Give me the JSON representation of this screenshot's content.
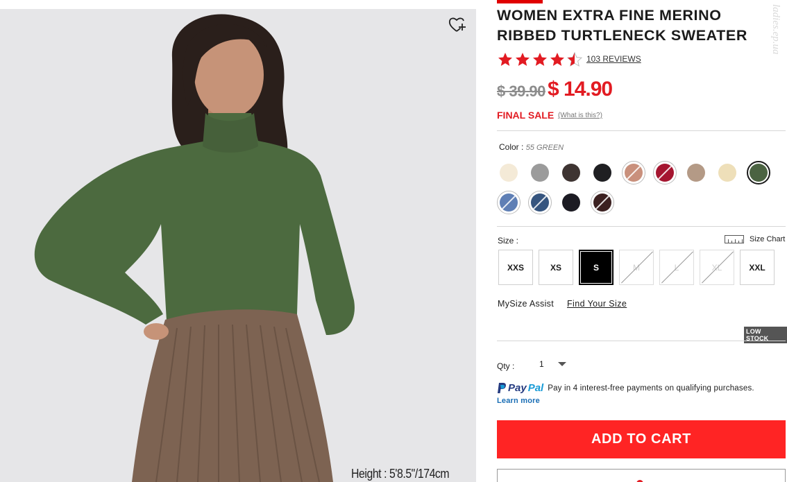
{
  "product": {
    "title": "WOMEN EXTRA FINE MERINO RIBBED TURTLENECK SWEATER",
    "rating": 4.5,
    "reviews_label": "103 REVIEWS",
    "original_price": "$ 39.90",
    "sale_price": "$ 14.90",
    "final_sale_label": "FINAL SALE",
    "what_is_label": "(What is this?)"
  },
  "photo": {
    "height_caption": "Height : 5'8.5\"/174cm",
    "wishlist_icon": "heart-plus-icon"
  },
  "watermark": "ladies.ep.ua",
  "color": {
    "label": "Color :",
    "selected_value": "55 GREEN",
    "swatches": [
      {
        "name": "cream",
        "color": "#f4ead7",
        "selected": false,
        "sold_out": false
      },
      {
        "name": "light-gray",
        "color": "#9b9b9b",
        "selected": false,
        "sold_out": false
      },
      {
        "name": "dark-brown",
        "color": "#3e3432",
        "selected": false,
        "sold_out": false
      },
      {
        "name": "black",
        "color": "#1f1f22",
        "selected": false,
        "sold_out": false
      },
      {
        "name": "pink-beige",
        "color": "#c9907c",
        "selected": false,
        "sold_out": true
      },
      {
        "name": "red",
        "color": "#a51530",
        "selected": false,
        "sold_out": true
      },
      {
        "name": "beige",
        "color": "#b49a86",
        "selected": false,
        "sold_out": false
      },
      {
        "name": "yellow",
        "color": "#eedfb9",
        "selected": false,
        "sold_out": false
      },
      {
        "name": "green",
        "color": "#4b6342",
        "selected": true,
        "sold_out": false
      },
      {
        "name": "light-blue",
        "color": "#5f7fb5",
        "selected": false,
        "sold_out": true
      },
      {
        "name": "navy-blue",
        "color": "#36557f",
        "selected": false,
        "sold_out": true
      },
      {
        "name": "dark-navy",
        "color": "#1c1b23",
        "selected": false,
        "sold_out": false
      },
      {
        "name": "wine-brown",
        "color": "#3b2020",
        "selected": false,
        "sold_out": true
      }
    ]
  },
  "size": {
    "label": "Size :",
    "chart_label": "Size Chart",
    "options": [
      {
        "label": "XXS",
        "state": "available"
      },
      {
        "label": "XS",
        "state": "available"
      },
      {
        "label": "S",
        "state": "selected"
      },
      {
        "label": "M",
        "state": "disabled"
      },
      {
        "label": "L",
        "state": "disabled"
      },
      {
        "label": "XL",
        "state": "disabled"
      },
      {
        "label": "XXL",
        "state": "available"
      }
    ]
  },
  "mysize": {
    "label": "MySize Assist",
    "link": "Find Your Size"
  },
  "stock_badge": "LOW STOCK",
  "quantity": {
    "label": "Qty :",
    "value": "1"
  },
  "paypal": {
    "brand_pay": "Pay",
    "brand_pal": "Pal",
    "text": "Pay in 4 interest-free payments on qualifying purchases.",
    "learn_more": "Learn more"
  },
  "cart": {
    "add_label": "ADD TO CART"
  },
  "colors": {
    "accent_red": "#ff2424",
    "price_red": "#e21b22",
    "link_blue": "#1a6eb5"
  }
}
